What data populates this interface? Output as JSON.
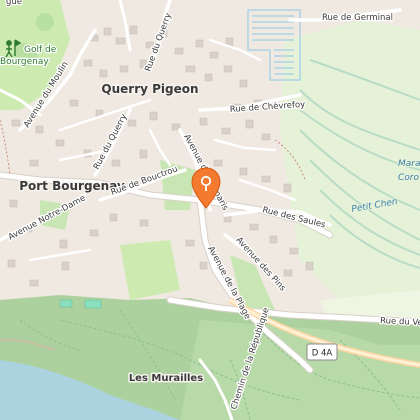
{
  "places": [
    {
      "name": "Querry Pigeon",
      "size": 12
    },
    {
      "name": "Port Bourgenay",
      "size": 12
    },
    {
      "name": "Les Murailles",
      "size": 10
    }
  ],
  "streets": {
    "germinal": "Rue de Germinal",
    "chevrefoy": "Rue de Chèvrefoy",
    "moulin": "Avenue du Moulin",
    "querry_n": "Rue du Querry",
    "querry_s": "Rue du Querry",
    "tamaris": "Avenue des Tamaris",
    "bouctrou": "Rue de Bouctrou",
    "dame": "Avenue Notre-Dame",
    "saules": "Rue des Saules",
    "pins": "Avenue des Pins",
    "plage": "Avenue de la Plage",
    "veil": "Rue du Veil",
    "republique": "Chemin de la République",
    "fragment_top": "gue"
  },
  "poi": {
    "golf": "Golf de Bourgenay"
  },
  "water_labels": [
    "Mara",
    "Coro",
    "Petit Chen"
  ],
  "route_shield": "D 4A",
  "marker": {
    "icon": "location-pin-icon",
    "color": "#f47a30"
  },
  "colors": {
    "background": "#efe9e1",
    "forest": "#add19e",
    "park": "#c8e6b3",
    "grass": "#cdebb0",
    "water": "#aad3df",
    "road": "#ffffff",
    "road_casing": "#d8d0c8",
    "building": "#d9d0c9",
    "marsh": "#e6f2d8",
    "track": "#8fbf8f"
  }
}
